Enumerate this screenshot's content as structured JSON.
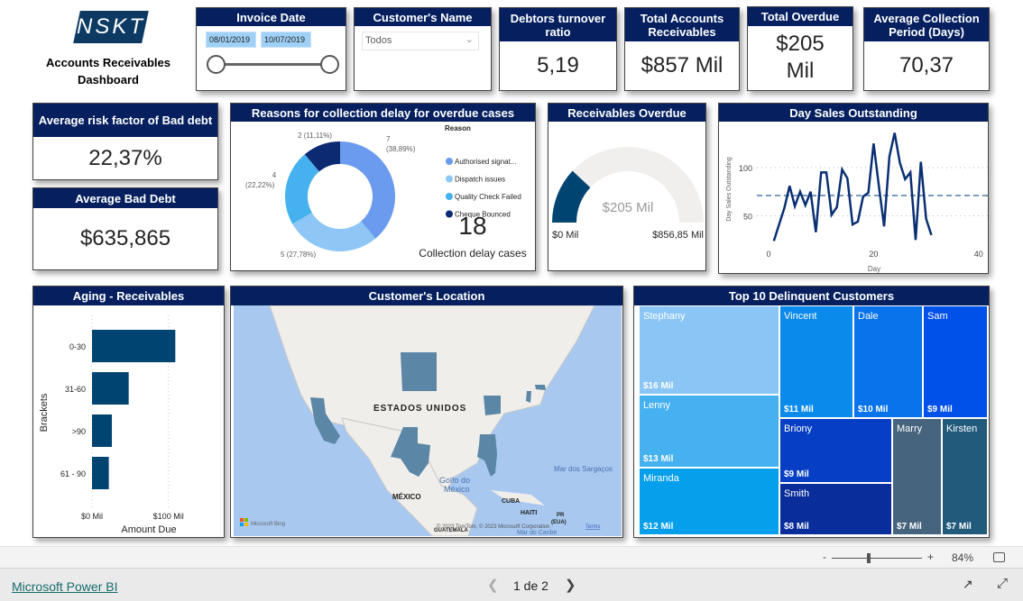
{
  "header": {
    "logo_text": "NSKT",
    "title": "Accounts Receivables Dashboard"
  },
  "invoice_date": {
    "title": "Invoice Date",
    "start": "08/01/2019",
    "end": "10/07/2019"
  },
  "customer_filter": {
    "title": "Customer's Name",
    "selected": "Todos"
  },
  "kpis": {
    "debtors_turnover": {
      "title": "Debtors turnover ratio",
      "value": "5,19"
    },
    "total_ar": {
      "title": "Total Accounts Receivables",
      "value": "$857 Mil"
    },
    "total_overdue": {
      "title": "Total Overdue",
      "value": "$205 Mil"
    },
    "avg_collection": {
      "title": "Average Collection Period (Days)",
      "value": "70,37"
    },
    "avg_risk": {
      "title": "Average risk factor of Bad debt",
      "value": "22,37%"
    },
    "avg_bad_debt": {
      "title": "Average Bad Debt",
      "value": "$635,865"
    }
  },
  "colors": {
    "header": "#06205f",
    "bar": "#004472",
    "line": "#0a2f73",
    "avg_line": "#7a9bbd",
    "gauge_fill": "#004472",
    "gauge_bg": "#f0efee",
    "map_water": "#a8c8f0",
    "map_land": "#efeeea",
    "map_highlight": "#5b86a6"
  },
  "chart_data": [
    {
      "type": "pie",
      "title": "Reasons for collection delay for overdue cases",
      "legend_title": "Reason",
      "legend_position": "right",
      "slices": [
        {
          "name": "Authorised signat...",
          "value": 7,
          "label": "7",
          "pct": "(38,89%)",
          "color": "#6a9bee"
        },
        {
          "name": "Dispatch issues",
          "value": 5,
          "label": "5",
          "pct": "(27,78%)",
          "color": "#8ec7f5"
        },
        {
          "name": "Quality Check Failed",
          "value": 4,
          "label": "4",
          "pct": "(22,22%)",
          "color": "#45b2ef"
        },
        {
          "name": "Cheque Bounced",
          "value": 2,
          "label": "2",
          "pct": "(11,11%)",
          "color": "#0c2a72"
        }
      ],
      "card_value": "18",
      "card_label": "Collection delay cases"
    },
    {
      "type": "gauge",
      "title": "Receivables Overdue",
      "value": 205,
      "max": 856.85,
      "value_label": "$205 Mil",
      "min_label": "$0 Mil",
      "max_label": "$856,85 Mil"
    },
    {
      "type": "line",
      "title": "Day Sales Outstanding",
      "xlabel": "Day",
      "ylabel": "Day Sales Outstanding",
      "xlim": [
        0,
        40
      ],
      "ylim": [
        15,
        145
      ],
      "xticks": [
        "0",
        "20",
        "40"
      ],
      "yticks": [
        "50",
        "100"
      ],
      "average": 71,
      "x": [
        1,
        2,
        3,
        4,
        5,
        6,
        7,
        8,
        9,
        10,
        11,
        12,
        13,
        14,
        15,
        16,
        17,
        18,
        19,
        20,
        21,
        22,
        23,
        24,
        25,
        26,
        27,
        28,
        29,
        30,
        31
      ],
      "y": [
        24,
        41,
        58,
        81,
        60,
        75,
        61,
        75,
        33,
        95,
        95,
        51,
        59,
        98,
        89,
        41,
        44,
        70,
        74,
        125,
        81,
        39,
        111,
        136,
        105,
        88,
        95,
        25,
        106,
        47,
        30
      ]
    },
    {
      "type": "bar",
      "orientation": "horizontal",
      "title": "Aging - Receivables",
      "xlabel": "Amount Due",
      "ylabel": "Brackets",
      "categories": [
        "0-30",
        "31-60",
        ">90",
        "61 - 90"
      ],
      "values": [
        109,
        48,
        26,
        22
      ],
      "xlim": [
        0,
        100
      ],
      "xticks": [
        "$0 Mil",
        "$100 Mil"
      ],
      "grid": true
    },
    {
      "type": "treemap",
      "title": "Top 10 Delinquent Customers",
      "items": [
        {
          "name": "Stephany",
          "label": "$16 Mil",
          "value": 16,
          "color": "#8ac5f5"
        },
        {
          "name": "Lenny",
          "label": "$13 Mil",
          "value": 13,
          "color": "#46b1f0"
        },
        {
          "name": "Miranda",
          "label": "$12 Mil",
          "value": 12,
          "color": "#059fec"
        },
        {
          "name": "Vincent",
          "label": "$11 Mil",
          "value": 11,
          "color": "#0a8aeb"
        },
        {
          "name": "Dale",
          "label": "$10 Mil",
          "value": 10,
          "color": "#0873ea"
        },
        {
          "name": "Sam",
          "label": "$9 Mil",
          "value": 9,
          "color": "#0050ea"
        },
        {
          "name": "Briony",
          "label": "$9 Mil",
          "value": 9,
          "color": "#073fc4"
        },
        {
          "name": "Smith",
          "label": "$8 Mil",
          "value": 8,
          "color": "#0a2d9c"
        },
        {
          "name": "Marry",
          "label": "$7 Mil",
          "value": 7,
          "color": "#46647e"
        },
        {
          "name": "Kirsten",
          "label": "$7 Mil",
          "value": 7,
          "color": "#225a7c"
        }
      ]
    }
  ],
  "map": {
    "title": "Customer's Location",
    "labels": {
      "usa": "ESTADOS UNIDOS",
      "mexico": "MÉXICO",
      "gulf1": "Golfo do",
      "gulf2": "México",
      "cuba": "CUBA",
      "haiti": "HAITI",
      "pr1": "PR",
      "pr2": "(EUA)",
      "sargasso": "Mar dos Sargaços",
      "caribbean": "Mar do Caribe",
      "guatemala": "GUATEMALA"
    },
    "bing": "Microsoft Bing",
    "copyright": "© 2023 TomTom, © 2023 Microsoft Corporation",
    "terms": "Terms"
  },
  "zoom": {
    "minus": "-",
    "plus": "+",
    "level": "84%",
    "percent": 84
  },
  "footer": {
    "brand": "Microsoft Power BI",
    "page": "1 de 2"
  }
}
